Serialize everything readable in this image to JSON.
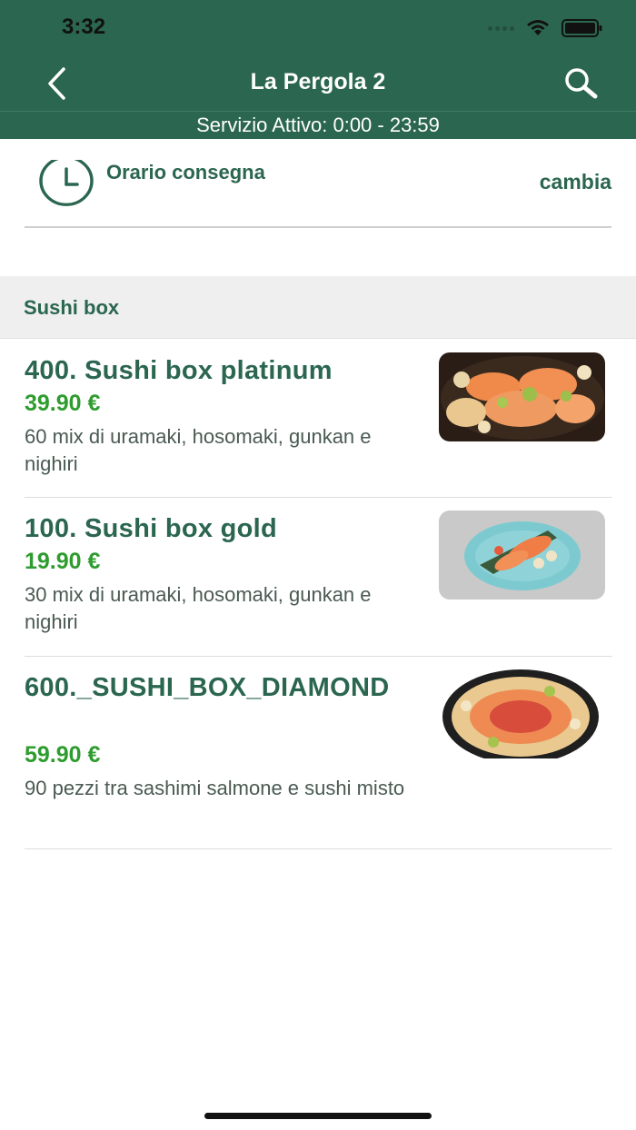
{
  "status_bar": {
    "time": "3:32"
  },
  "nav": {
    "title": "La Pergola 2"
  },
  "service": {
    "text": "Servizio Attivo: 0:00 - 23:59"
  },
  "delivery": {
    "label": "Orario consegna",
    "change_label": "cambia"
  },
  "section": {
    "title": "Sushi box"
  },
  "items": [
    {
      "name": "400. Sushi box platinum",
      "price": "39.90 €",
      "description": "60 mix di uramaki, hosomaki, gunkan e nighiri"
    },
    {
      "name": "100. Sushi box gold",
      "price": "19.90 €",
      "description": "30 mix di uramaki, hosomaki, gunkan e nighiri"
    },
    {
      "name": "600._SUSHI_BOX_DIAMOND",
      "price": "59.90 €",
      "description": "90 pezzi tra sashimi salmone e sushi misto"
    }
  ],
  "colors": {
    "brand_green": "#2b6650",
    "price_green": "#2e9c2e"
  },
  "icons": [
    "back-chevron-icon",
    "search-icon",
    "clock-icon",
    "wifi-icon",
    "battery-icon"
  ]
}
